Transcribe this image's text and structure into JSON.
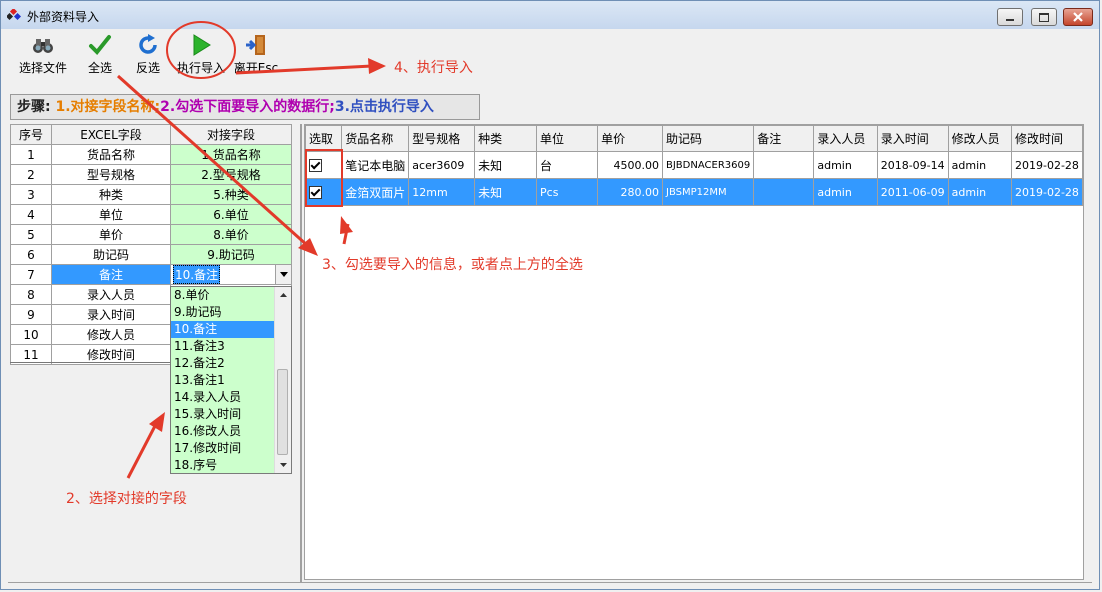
{
  "window": {
    "title": "外部资料导入"
  },
  "toolbar": {
    "select_file": "选择文件",
    "select_all": "全选",
    "invert": "反选",
    "execute_import": "执行导入",
    "exit": "离开Esc"
  },
  "steps": {
    "prefix": "步骤: ",
    "step1": "1.对接字段名称;",
    "step2": "2.勾选下面要导入的数据行;",
    "step3": "3.点击执行导入"
  },
  "mapping": {
    "headers": [
      "序号",
      "EXCEL字段",
      "对接字段"
    ],
    "rows": [
      {
        "no": "1",
        "excel": "货品名称",
        "map": "1.货品名称"
      },
      {
        "no": "2",
        "excel": "型号规格",
        "map": "2.型号规格"
      },
      {
        "no": "3",
        "excel": "种类",
        "map": "5.种类"
      },
      {
        "no": "4",
        "excel": "单位",
        "map": "6.单位"
      },
      {
        "no": "5",
        "excel": "单价",
        "map": "8.单价"
      },
      {
        "no": "6",
        "excel": "助记码",
        "map": "9.助记码"
      },
      {
        "no": "7",
        "excel": "备注",
        "map": "10.备注"
      },
      {
        "no": "8",
        "excel": "录入人员",
        "map": ""
      },
      {
        "no": "9",
        "excel": "录入时间",
        "map": ""
      },
      {
        "no": "10",
        "excel": "修改人员",
        "map": ""
      },
      {
        "no": "11",
        "excel": "修改时间",
        "map": ""
      }
    ],
    "dropdown_options": [
      "8.单价",
      "9.助记码",
      "10.备注",
      "11.备注3",
      "12.备注2",
      "13.备注1",
      "14.录入人员",
      "15.录入时间",
      "16.修改人员",
      "17.修改时间",
      "18.序号"
    ]
  },
  "data_grid": {
    "headers": [
      "选取",
      "货品名称",
      "型号规格",
      "种类",
      "单位",
      "单价",
      "助记码",
      "备注",
      "录入人员",
      "录入时间",
      "修改人员",
      "修改时间"
    ],
    "rows": [
      [
        "",
        "笔记本电脑",
        "acer3609",
        "未知",
        "台",
        "4500.00",
        "BJBDNACER3609",
        "",
        "admin",
        "2018-09-14",
        "admin",
        "2019-02-28"
      ],
      [
        "",
        "金箔双面片",
        "12mm",
        "未知",
        "Pcs",
        "280.00",
        "JBSMP12MM",
        "",
        "admin",
        "2011-06-09",
        "admin",
        "2019-02-28"
      ]
    ]
  },
  "annotations": {
    "a2": "2、选择对接的字段",
    "a3": "3、勾选要导入的信息，或者点上方的全选",
    "a4": "4、执行导入"
  },
  "colors": {
    "annotation_red": "#e23a2a",
    "selection_blue": "#3399ff",
    "mapped_green": "#ccffcc",
    "step1_orange": "#e67e00",
    "step2_purple": "#b000b0",
    "step3_blue": "#3050c0"
  }
}
